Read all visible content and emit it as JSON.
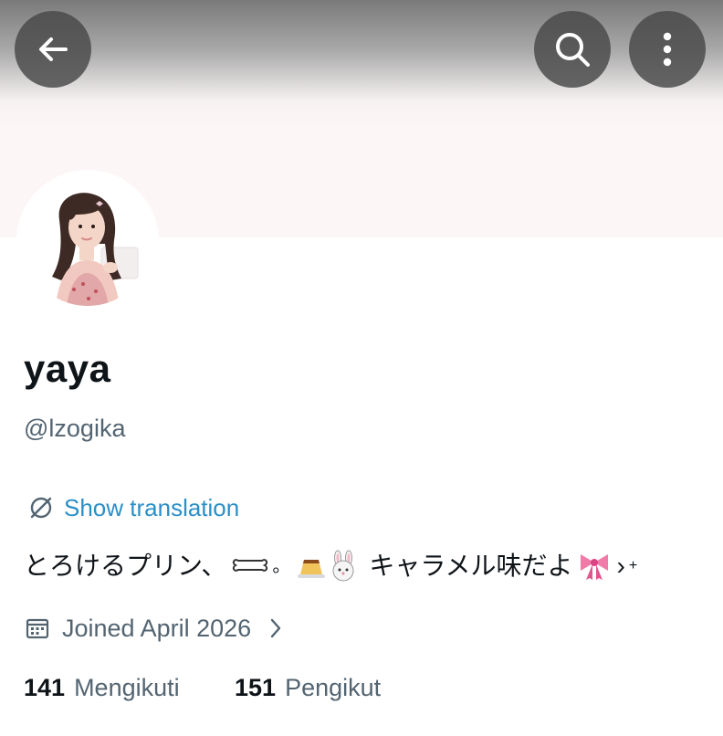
{
  "profile": {
    "display_name": "yaya",
    "handle": "@lzogika",
    "translate_label": "Show translation",
    "bio_text": "とろけるプリン、",
    "bio_mid": "キャラメル味だよ",
    "bio_tail": "›",
    "bio_plus": "+",
    "joined": "Joined April 2026",
    "following_count": "141",
    "following_label": "Mengikuti",
    "followers_count": "151",
    "followers_label": "Pengikut"
  },
  "icons": {
    "back": "arrow-left-icon",
    "search": "search-icon",
    "more": "more-vertical-icon",
    "translate": "globe-slash-icon",
    "calendar": "calendar-icon",
    "chevron": "chevron-right-icon",
    "bio_emojis": [
      "bone-icon",
      "pudding-icon",
      "rabbit-icon",
      "ribbon-icon"
    ]
  },
  "colors": {
    "link": "#2a8fc7",
    "secondary_text": "#536471",
    "primary_text": "#0f1419",
    "header_button": "#484848",
    "banner": "#fdf6f6"
  }
}
